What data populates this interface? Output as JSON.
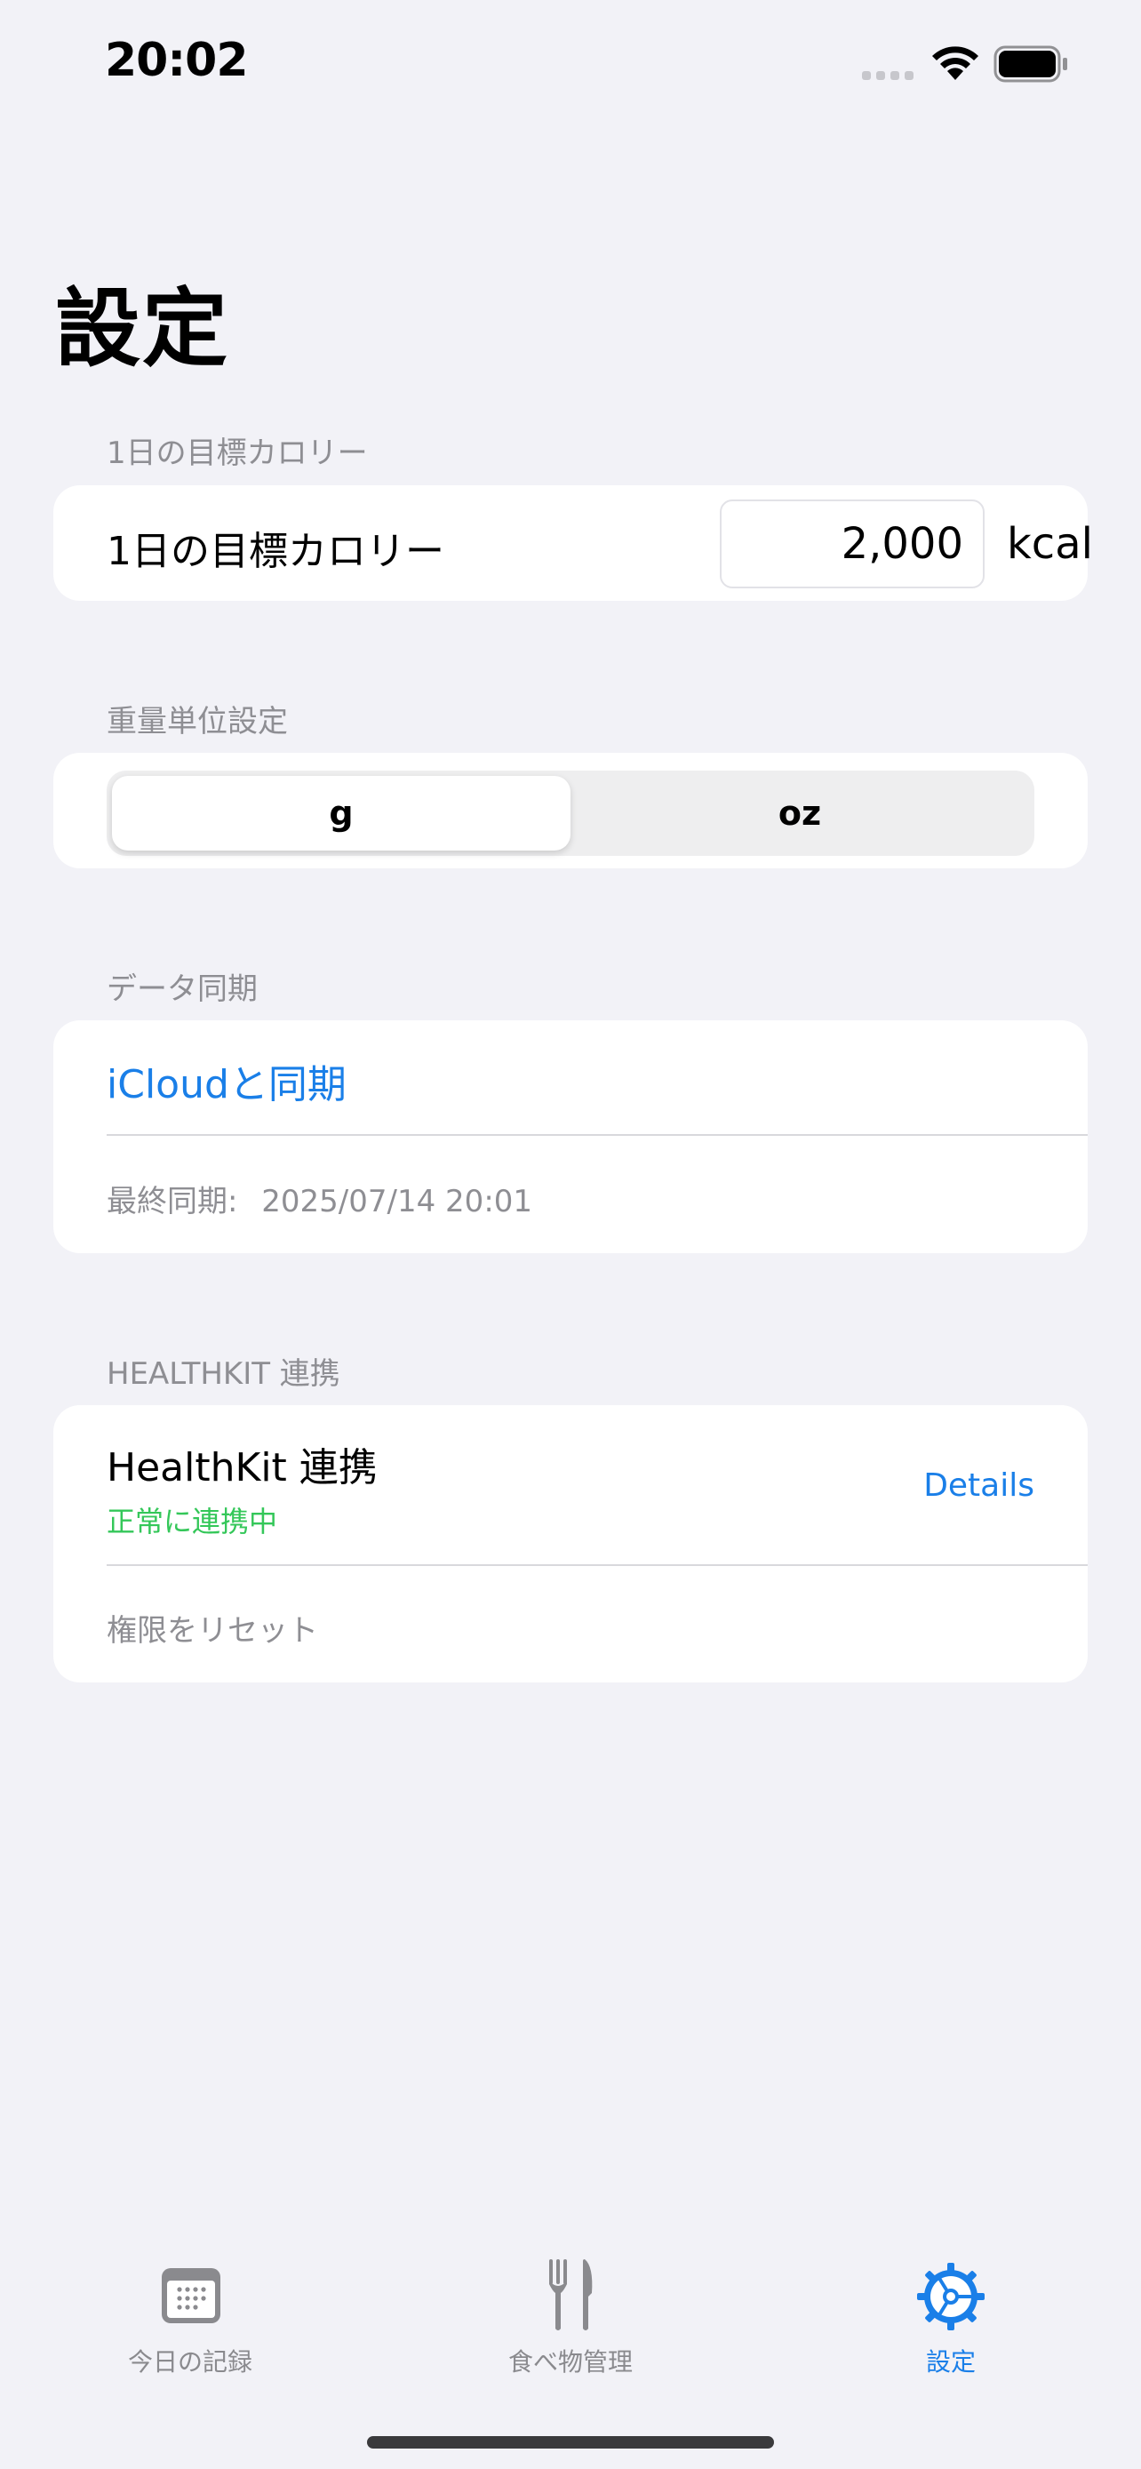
{
  "status_bar": {
    "time": "20:02"
  },
  "page": {
    "title": "設定"
  },
  "calorie_section": {
    "header": "1日の目標カロリー",
    "label": "1日の目標カロリー",
    "value": "2,000",
    "unit": "kcal"
  },
  "weight_section": {
    "header": "重量単位設定",
    "options": [
      "g",
      "oz"
    ],
    "selected": "g"
  },
  "sync_section": {
    "header": "データ同期",
    "sync_button": "iCloudと同期",
    "last_sync_label": "最終同期:",
    "last_sync_value": "2025/07/14 20:01"
  },
  "healthkit_section": {
    "header": "HEALTHKIT 連携",
    "title": "HealthKit 連携",
    "status": "正常に連携中",
    "details_link": "Details",
    "reset": "権限をリセット"
  },
  "tab_bar": {
    "items": [
      {
        "label": "今日の記録",
        "icon": "calendar-icon",
        "active": false
      },
      {
        "label": "食べ物管理",
        "icon": "fork-knife-icon",
        "active": false
      },
      {
        "label": "設定",
        "icon": "gear-icon",
        "active": true
      }
    ]
  },
  "colors": {
    "accent": "#1A7FE8",
    "success": "#34C759",
    "secondary_text": "#8E8E93",
    "background": "#F2F2F7",
    "tab_inactive": "#8A8A8E"
  }
}
